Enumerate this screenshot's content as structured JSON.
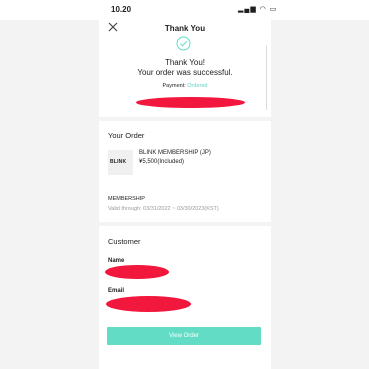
{
  "status_bar": {
    "time": "10.20",
    "icons": "▂▄▆ ◠ ▭"
  },
  "nav": {
    "title": "Thank You"
  },
  "confirmation": {
    "line1": "Thank You!",
    "line2": "Your order was successful.",
    "payment_label": "Payment:",
    "payment_status": "Ordered"
  },
  "order": {
    "section_title": "Your Order",
    "thumb_text": "BLINK",
    "product_name": "BLINK MEMBERSHIP (JP)",
    "product_price": "¥5,500(Included)",
    "membership_label": "MEMBERSHIP",
    "valid_through": "Valid through: 03/31/2022 ~ 03/30/2023(KST)"
  },
  "customer": {
    "section_title": "Customer",
    "name_label": "Name",
    "email_label": "Email"
  },
  "button": {
    "view_order": "View Order"
  },
  "colors": {
    "accent": "#62dcc4",
    "redaction": "#f2173d"
  }
}
